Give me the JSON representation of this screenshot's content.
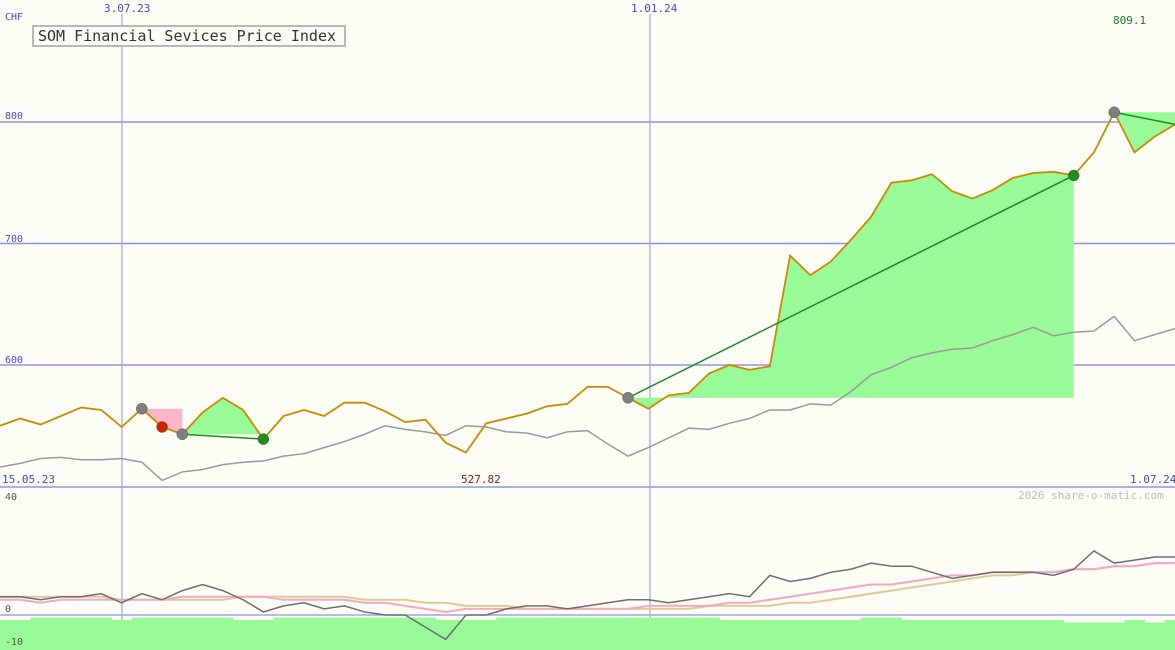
{
  "title": "SOM Financial Sevices Price Index",
  "currency": "CHF",
  "watermark": "2026 share-o-matic.com",
  "colors": {
    "background": "#fdfdf6",
    "grid": "#8b96e0",
    "price": "#cc8a00",
    "fill_up": "#98fb98",
    "fill_down": "#f8b6c8",
    "trend": "#1e8c1e",
    "index": "#9a9a9a",
    "axis_text": "#3b4fc4",
    "high_text": "#1e7a1e",
    "low_text": "#8b1a1a",
    "osc_main": "#6e6e6e",
    "osc_pink": "#f5a9bd",
    "osc_tan": "#e2c99b"
  },
  "chart_data": [
    {
      "type": "line",
      "title": "SOM Financial Sevices Price Index",
      "ylabel": "CHF",
      "ylim": [
        500,
        850
      ],
      "y_ticks": [
        600,
        700,
        800
      ],
      "x_top_labels": [
        "3.07.23",
        "1.01.24"
      ],
      "x_start_label": "15.05.23",
      "x_end_label": "1.07.24",
      "annotations": {
        "high": "809.1",
        "low": "527.82"
      },
      "x": [
        0,
        1,
        2,
        3,
        4,
        5,
        6,
        7,
        8,
        9,
        10,
        11,
        12,
        13,
        14,
        15,
        16,
        17,
        18,
        19,
        20,
        21,
        22,
        23,
        24,
        25,
        26,
        27,
        28,
        29,
        30,
        31,
        32,
        33,
        34,
        35,
        36,
        37,
        38,
        39,
        40,
        41,
        42,
        43,
        44,
        45,
        46,
        47,
        48,
        49,
        50,
        51,
        52,
        53,
        54,
        55,
        56,
        57,
        58
      ],
      "series": [
        {
          "values": [
            550,
            556,
            551,
            558,
            565,
            563,
            549,
            564,
            549,
            543,
            561,
            573,
            563,
            539,
            558,
            563,
            558,
            569,
            569,
            562,
            553,
            555,
            536,
            528,
            552,
            556,
            560,
            566,
            568,
            582,
            582,
            573,
            564,
            575,
            577,
            593,
            600,
            596,
            599,
            690,
            674,
            685,
            703,
            722,
            750,
            752,
            757,
            743,
            737,
            744,
            754,
            758,
            759,
            756,
            775,
            808,
            775,
            788,
            798
          ]
        },
        {
          "values": [
            516,
            519,
            523,
            524,
            522,
            522,
            523,
            520,
            505,
            512,
            514,
            518,
            520,
            521,
            525,
            527,
            532,
            537,
            543,
            550,
            547,
            545,
            542,
            550,
            549,
            545,
            544,
            540,
            545,
            546,
            535,
            525,
            532,
            540,
            548,
            547,
            552,
            556,
            563,
            563,
            568,
            567,
            578,
            592,
            598,
            606,
            610,
            613,
            614,
            620,
            625,
            631,
            624,
            627,
            628,
            640,
            620,
            625,
            630
          ]
        }
      ]
    },
    {
      "type": "line",
      "ylim": [
        -10,
        40
      ],
      "y_ticks": [
        40,
        0,
        -10
      ],
      "x": [
        0,
        1,
        2,
        3,
        4,
        5,
        6,
        7,
        8,
        9,
        10,
        11,
        12,
        13,
        14,
        15,
        16,
        17,
        18,
        19,
        20,
        21,
        22,
        23,
        24,
        25,
        26,
        27,
        28,
        29,
        30,
        31,
        32,
        33,
        34,
        35,
        36,
        37,
        38,
        39,
        40,
        41,
        42,
        43,
        44,
        45,
        46,
        47,
        48,
        49,
        50,
        51,
        52,
        53,
        54,
        55,
        56,
        57,
        58
      ],
      "series": [
        {
          "values": [
            6,
            6,
            5,
            6,
            6,
            7,
            4,
            7,
            5,
            8,
            10,
            8,
            5,
            1,
            3,
            4,
            2,
            3,
            1,
            0,
            0,
            -4,
            -8,
            0,
            0,
            2,
            3,
            3,
            2,
            3,
            4,
            5,
            5,
            4,
            5,
            6,
            7,
            6,
            13,
            11,
            12,
            14,
            15,
            17,
            16,
            16,
            14,
            12,
            13,
            14,
            14,
            14,
            13,
            15,
            21,
            17,
            18,
            19,
            19
          ]
        },
        {
          "values": [
            5,
            5,
            4,
            5,
            5,
            5,
            5,
            5,
            5,
            6,
            6,
            6,
            6,
            6,
            5,
            5,
            5,
            5,
            4,
            4,
            3,
            2,
            1,
            2,
            2,
            2,
            2,
            2,
            2,
            2,
            2,
            2,
            3,
            3,
            3,
            3,
            4,
            4,
            5,
            6,
            7,
            8,
            9,
            10,
            10,
            11,
            12,
            13,
            13,
            14,
            14,
            14,
            14,
            15,
            15,
            16,
            16,
            17,
            17
          ]
        },
        {
          "values": [
            6,
            6,
            6,
            6,
            6,
            6,
            5,
            5,
            5,
            5,
            5,
            5,
            6,
            6,
            6,
            6,
            6,
            6,
            5,
            5,
            5,
            4,
            4,
            3,
            3,
            3,
            2,
            2,
            2,
            2,
            2,
            2,
            2,
            2,
            2,
            3,
            3,
            3,
            3,
            4,
            4,
            5,
            6,
            7,
            8,
            9,
            10,
            11,
            12,
            13,
            13,
            14,
            14,
            15,
            15,
            16,
            16,
            17,
            17
          ]
        },
        {
          "type": "bar",
          "values": [
            -8,
            -8,
            -7,
            -7,
            -7,
            -7,
            -8,
            -7,
            -7,
            -7,
            -7,
            -7,
            -8,
            -8,
            -7,
            -7,
            -7,
            -7,
            -7,
            -7,
            -7,
            -7,
            -8,
            -8,
            -8,
            -7,
            -7,
            -7,
            -7,
            -7,
            -7,
            -7,
            -7,
            -7,
            -7,
            -7,
            -8,
            -8,
            -8,
            -8,
            -8,
            -8,
            -8,
            -7,
            -7,
            -8,
            -8,
            -8,
            -8,
            -8,
            -8,
            -8,
            -8,
            -9,
            -9,
            -9,
            -8,
            -9,
            -8
          ]
        }
      ]
    }
  ],
  "markers": [
    {
      "index": 7,
      "color": "#808080"
    },
    {
      "index": 8,
      "color": "#cc2200"
    },
    {
      "index": 9,
      "color": "#808080"
    },
    {
      "index": 13,
      "color": "#228b22"
    },
    {
      "index": 31,
      "color": "#808080"
    },
    {
      "index": 53,
      "color": "#228b22"
    },
    {
      "index": 55,
      "color": "#808080"
    }
  ],
  "shaded_regions": [
    {
      "from": 7,
      "to": 9,
      "kind": "down"
    },
    {
      "from": 9,
      "to": 13,
      "kind": "up"
    },
    {
      "from": 31,
      "to": 35,
      "kind": "down"
    },
    {
      "from": 31,
      "to": 53,
      "kind": "up"
    },
    {
      "from": 55,
      "to": 58,
      "kind": "up"
    }
  ],
  "trend_lines": [
    {
      "from": 9,
      "to": 13
    },
    {
      "from": 31,
      "to": 53
    },
    {
      "from": 55,
      "to": 58
    }
  ]
}
